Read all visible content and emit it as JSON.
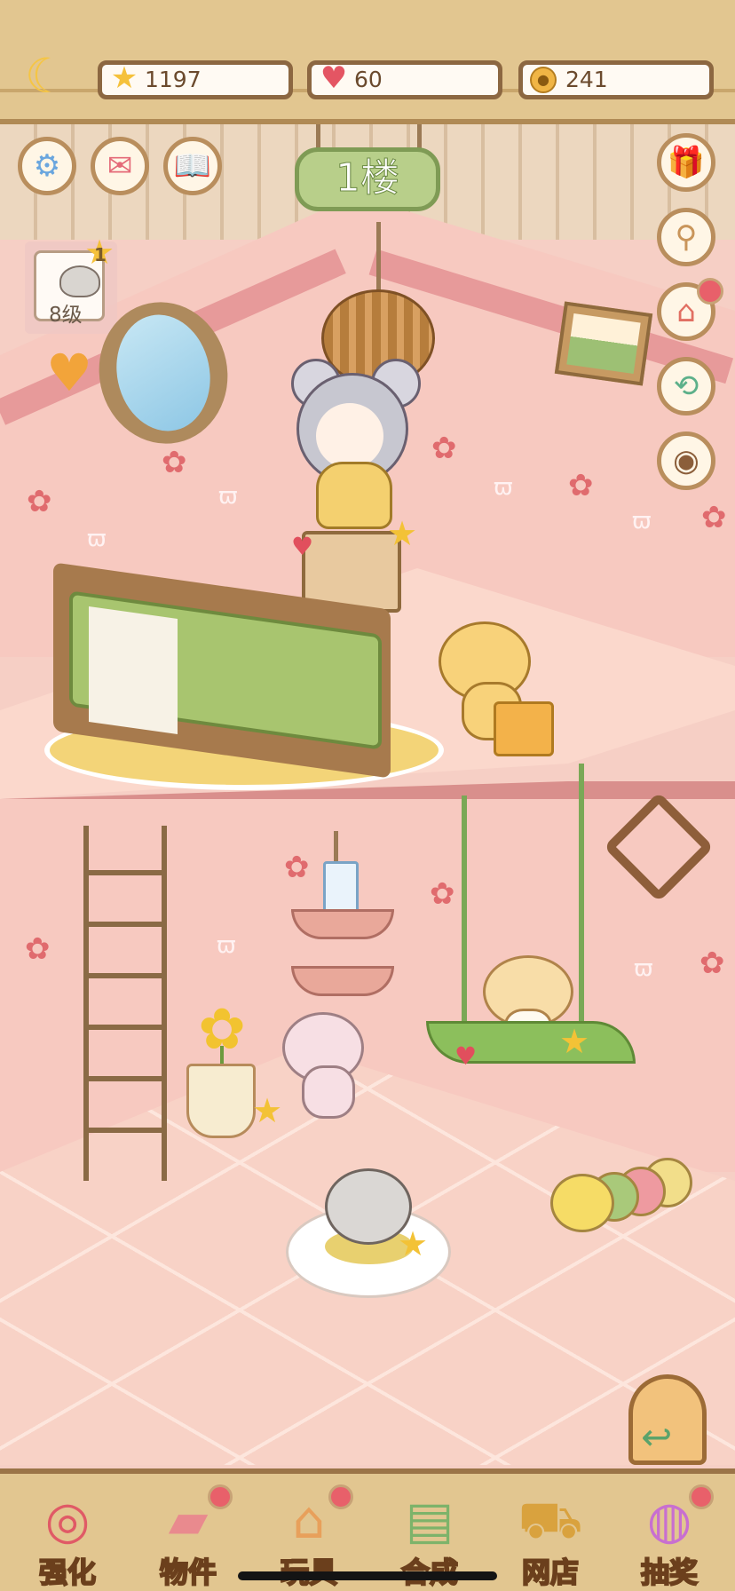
{
  "resources": {
    "stars": {
      "value": "1197",
      "icon": "star-icon"
    },
    "hearts": {
      "value": "60",
      "icon": "heart-icon"
    },
    "coins": {
      "value": "241",
      "icon": "paw-coin-icon"
    }
  },
  "floor_sign": "1楼",
  "level_card": {
    "level_label": "8级",
    "badge_count": "1"
  },
  "left_buttons": [
    "gear-icon",
    "mail-heart-icon",
    "star-book-icon"
  ],
  "right_buttons": [
    "gift-box-icon",
    "magnifier-paw-icon",
    "paw-house-icon",
    "rotate-house-icon",
    "eye-icon"
  ],
  "bottom_nav": [
    {
      "label": "强化",
      "icon": "lollipop-icon",
      "dot": false
    },
    {
      "label": "物件",
      "icon": "piano-icon",
      "dot": true
    },
    {
      "label": "玩具",
      "icon": "toy-house-icon",
      "dot": true
    },
    {
      "label": "合成",
      "icon": "card-merge-icon",
      "dot": false
    },
    {
      "label": "网店",
      "icon": "shop-basket-icon",
      "dot": false
    },
    {
      "label": "抽奖",
      "icon": "lottery-wheel-icon",
      "dot": true
    }
  ],
  "colors": {
    "wood": "#e2c690",
    "wall": "#f7c9c0",
    "floor": "#f8d2c6",
    "sign_green": "#b8cf8a",
    "star_yellow": "#f3c236",
    "notify_red": "#e8606a"
  }
}
